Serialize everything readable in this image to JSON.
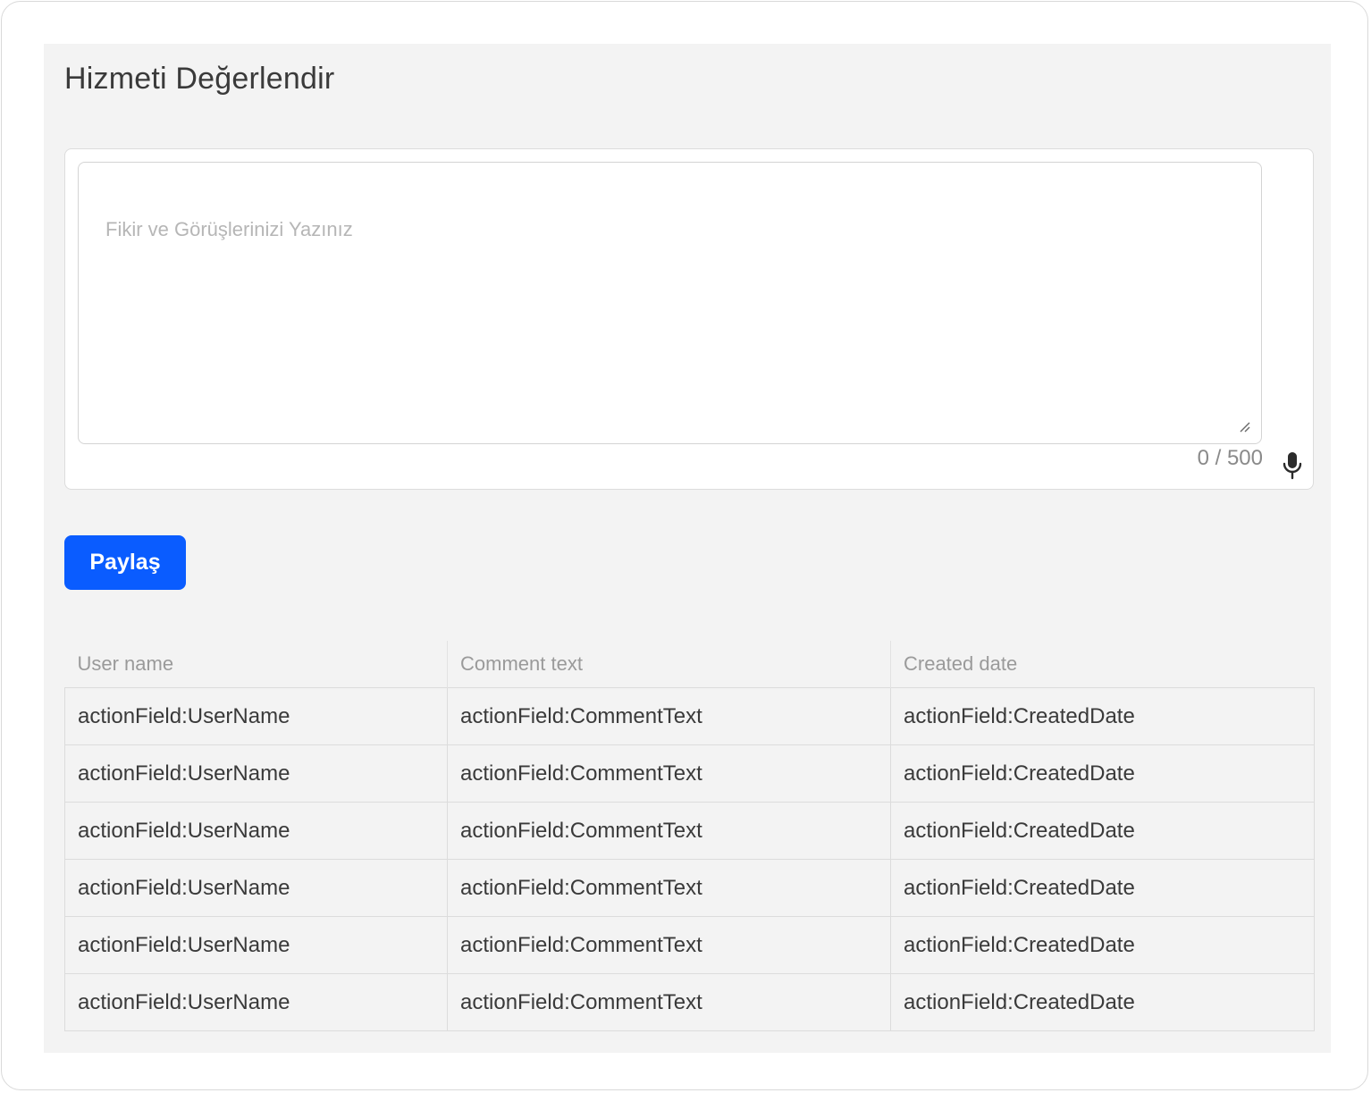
{
  "page": {
    "title": "Hizmeti Değerlendir"
  },
  "comment_form": {
    "placeholder": "Fikir ve Görüşlerinizi Yazınız",
    "value": "",
    "counter": "0 / 500",
    "mic_icon": "microphone-icon",
    "share_label": "Paylaş"
  },
  "colors": {
    "accent": "#0a5cff",
    "panel_background": "#f3f3f3"
  },
  "table": {
    "headers": [
      "User name",
      "Comment text",
      "Created date"
    ],
    "rows": [
      [
        "actionField:UserName",
        "actionField:CommentText",
        "actionField:CreatedDate"
      ],
      [
        "actionField:UserName",
        "actionField:CommentText",
        "actionField:CreatedDate"
      ],
      [
        "actionField:UserName",
        "actionField:CommentText",
        "actionField:CreatedDate"
      ],
      [
        "actionField:UserName",
        "actionField:CommentText",
        "actionField:CreatedDate"
      ],
      [
        "actionField:UserName",
        "actionField:CommentText",
        "actionField:CreatedDate"
      ],
      [
        "actionField:UserName",
        "actionField:CommentText",
        "actionField:CreatedDate"
      ]
    ]
  }
}
